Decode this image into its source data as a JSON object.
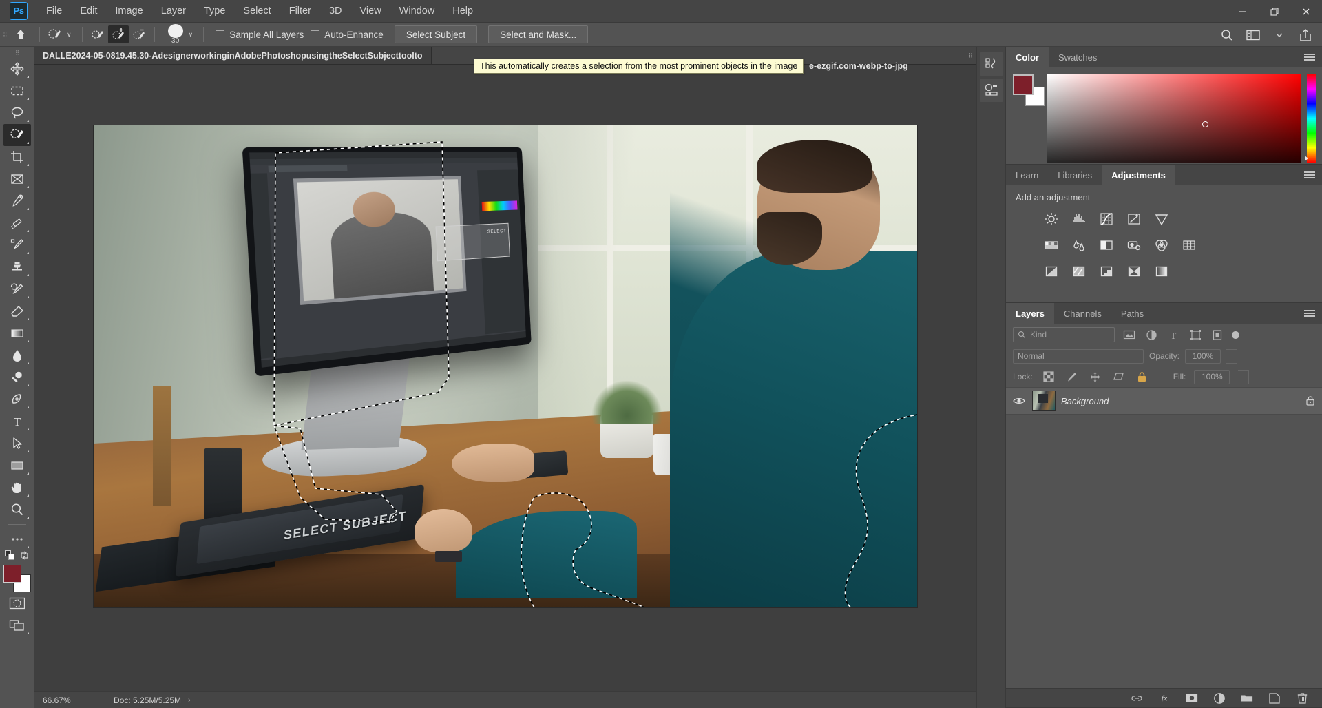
{
  "app": {
    "name": "Adobe Photoshop",
    "logo_text": "Ps"
  },
  "menubar": {
    "items": [
      {
        "label": "File"
      },
      {
        "label": "Edit"
      },
      {
        "label": "Image"
      },
      {
        "label": "Layer"
      },
      {
        "label": "Type"
      },
      {
        "label": "Select"
      },
      {
        "label": "Filter"
      },
      {
        "label": "3D"
      },
      {
        "label": "View"
      },
      {
        "label": "Window"
      },
      {
        "label": "Help"
      }
    ],
    "window_controls": {
      "minimize": "—",
      "maximize": "❐",
      "close": "✕"
    }
  },
  "options_bar": {
    "tool": "Quick Selection Tool",
    "brush_size": "30",
    "sample_all_layers": {
      "label": "Sample All Layers",
      "checked": false
    },
    "auto_enhance": {
      "label": "Auto-Enhance",
      "checked": false
    },
    "select_subject_label": "Select Subject",
    "select_and_mask_label": "Select and Mask...",
    "dropdown_caret": "∨"
  },
  "tooltip": {
    "text": "This automatically creates a selection from the most prominent objects in the image"
  },
  "document": {
    "tab_title": "DALLE2024-05-0819.45.30-AdesignerworkinginAdobePhotoshopusingtheSelectSubjecttoolto",
    "tab_title_trailing": "e-ezgif.com-webp-to-jpg",
    "zoom": "66.67%",
    "doc_size": "Doc: 5.25M/5.25M",
    "status_arrow": "›"
  },
  "toolbar": {
    "tools": [
      {
        "name": "move-tool",
        "title": "Move Tool"
      },
      {
        "name": "marquee-tool",
        "title": "Rectangular Marquee Tool"
      },
      {
        "name": "lasso-tool",
        "title": "Lasso Tool"
      },
      {
        "name": "quick-selection-tool",
        "title": "Quick Selection Tool",
        "active": true
      },
      {
        "name": "crop-tool",
        "title": "Crop Tool"
      },
      {
        "name": "frame-tool",
        "title": "Frame Tool"
      },
      {
        "name": "eyedropper-tool",
        "title": "Eyedropper Tool"
      },
      {
        "name": "spot-healing-brush-tool",
        "title": "Spot Healing Brush Tool"
      },
      {
        "name": "brush-tool",
        "title": "Brush Tool"
      },
      {
        "name": "clone-stamp-tool",
        "title": "Clone Stamp Tool"
      },
      {
        "name": "history-brush-tool",
        "title": "History Brush Tool"
      },
      {
        "name": "eraser-tool",
        "title": "Eraser Tool"
      },
      {
        "name": "gradient-tool",
        "title": "Gradient Tool"
      },
      {
        "name": "blur-tool",
        "title": "Blur Tool"
      },
      {
        "name": "dodge-tool",
        "title": "Dodge Tool"
      },
      {
        "name": "pen-tool",
        "title": "Pen Tool"
      },
      {
        "name": "type-tool",
        "title": "Horizontal Type Tool"
      },
      {
        "name": "path-selection-tool",
        "title": "Path Selection Tool"
      },
      {
        "name": "rectangle-tool",
        "title": "Rectangle Tool"
      },
      {
        "name": "hand-tool",
        "title": "Hand Tool"
      },
      {
        "name": "zoom-tool",
        "title": "Zoom Tool"
      },
      {
        "name": "edit-toolbar-tool",
        "title": "Edit Toolbar"
      }
    ],
    "foreground_color": "#7d1f2a",
    "background_color": "#ffffff",
    "quick_mask_label": "Edit in Quick Mask Mode",
    "screen_mode_label": "Change Screen Mode"
  },
  "color_panel": {
    "tabs": [
      {
        "label": "Color",
        "active": true
      },
      {
        "label": "Swatches",
        "active": false
      }
    ],
    "foreground": "#7d1f2a",
    "background": "#ffffff"
  },
  "adjustments_panel": {
    "tabs": [
      {
        "label": "Learn",
        "active": false
      },
      {
        "label": "Libraries",
        "active": false
      },
      {
        "label": "Adjustments",
        "active": true
      }
    ],
    "heading": "Add an adjustment",
    "rows": [
      [
        {
          "name": "brightness-contrast-icon",
          "title": "Brightness/Contrast"
        },
        {
          "name": "levels-icon",
          "title": "Levels"
        },
        {
          "name": "curves-icon",
          "title": "Curves"
        },
        {
          "name": "exposure-icon",
          "title": "Exposure"
        },
        {
          "name": "vibrance-icon",
          "title": "Vibrance"
        }
      ],
      [
        {
          "name": "hue-saturation-icon",
          "title": "Hue/Saturation"
        },
        {
          "name": "color-balance-icon",
          "title": "Color Balance"
        },
        {
          "name": "black-white-icon",
          "title": "Black & White"
        },
        {
          "name": "photo-filter-icon",
          "title": "Photo Filter"
        },
        {
          "name": "channel-mixer-icon",
          "title": "Channel Mixer"
        },
        {
          "name": "color-lookup-icon",
          "title": "Color Lookup"
        }
      ],
      [
        {
          "name": "invert-icon",
          "title": "Invert"
        },
        {
          "name": "posterize-icon",
          "title": "Posterize"
        },
        {
          "name": "threshold-icon",
          "title": "Threshold"
        },
        {
          "name": "gradient-map-icon",
          "title": "Gradient Map"
        },
        {
          "name": "selective-color-icon",
          "title": "Selective Color"
        }
      ]
    ]
  },
  "layers_panel": {
    "tabs": [
      {
        "label": "Layers",
        "active": true
      },
      {
        "label": "Channels",
        "active": false
      },
      {
        "label": "Paths",
        "active": false
      }
    ],
    "filter_placeholder": "Kind",
    "blend_mode": "Normal",
    "opacity_label": "Opacity:",
    "opacity_value": "100%",
    "lock_label": "Lock:",
    "fill_label": "Fill:",
    "fill_value": "100%",
    "layers": [
      {
        "name": "Background",
        "locked": true,
        "visible": true
      }
    ],
    "footer_icons": [
      {
        "name": "link-layers-icon",
        "glyph": "⚭"
      },
      {
        "name": "layer-style-icon",
        "glyph": "fx"
      },
      {
        "name": "layer-mask-icon",
        "glyph": ""
      },
      {
        "name": "adjustment-layer-icon",
        "glyph": ""
      },
      {
        "name": "new-group-icon",
        "glyph": ""
      },
      {
        "name": "new-layer-icon",
        "glyph": ""
      },
      {
        "name": "delete-layer-icon",
        "glyph": ""
      }
    ]
  },
  "right_strip": {
    "buttons": [
      {
        "name": "history-panel-button",
        "title": "History"
      },
      {
        "name": "properties-panel-button",
        "title": "Properties"
      }
    ]
  },
  "colors": {
    "menu_bg": "#454545",
    "panel_bg": "#535353",
    "canvas_bg": "#3f3f3f",
    "accent": "#31a8ff",
    "text": "#d4d4d4",
    "tooltip_bg": "#fdfbd2"
  },
  "canvas_scene": {
    "monitor_select_label": "SELECT",
    "tablet_label": "SELECT SUBJECT"
  }
}
